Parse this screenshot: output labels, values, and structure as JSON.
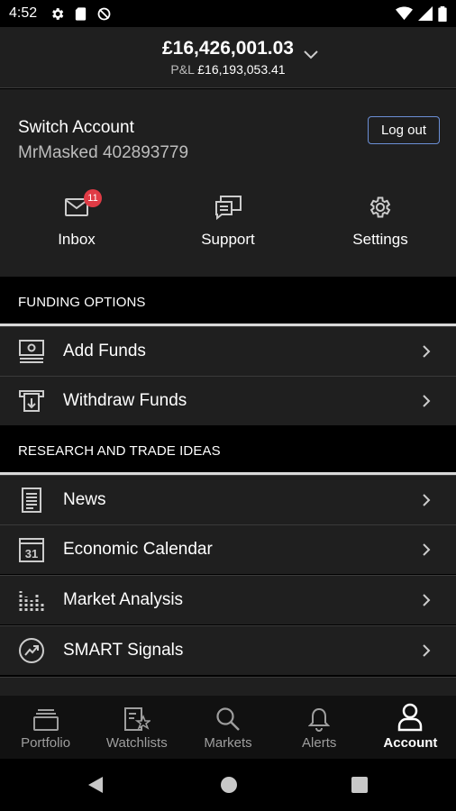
{
  "status_bar": {
    "time": "4:52",
    "left_icons": [
      "gear-icon",
      "sd-card-icon",
      "no-sync-icon"
    ],
    "right_icons": [
      "wifi-icon",
      "signal-icon",
      "battery-icon"
    ]
  },
  "header": {
    "balance": "£16,426,001.03",
    "pnl_label": "P&L",
    "pnl_value": "£16,193,053.41"
  },
  "account": {
    "switch_label": "Switch Account",
    "account_name": "MrMasked 402893779",
    "logout_label": "Log out"
  },
  "quick_actions": [
    {
      "label": "Inbox",
      "icon": "mail-icon",
      "badge": "11"
    },
    {
      "label": "Support",
      "icon": "chat-icon"
    },
    {
      "label": "Settings",
      "icon": "gear-icon"
    }
  ],
  "sections": {
    "funding": {
      "title": "FUNDING OPTIONS",
      "items": [
        {
          "label": "Add Funds",
          "icon": "add-funds-icon"
        },
        {
          "label": "Withdraw Funds",
          "icon": "withdraw-funds-icon"
        }
      ]
    },
    "research": {
      "title": "RESEARCH AND TRADE IDEAS",
      "items": [
        {
          "label": "News",
          "icon": "news-icon"
        },
        {
          "label": "Economic Calendar",
          "icon": "calendar-icon",
          "icon_text": "31"
        },
        {
          "label": "Market Analysis",
          "icon": "bar-chart-icon"
        },
        {
          "label": "SMART Signals",
          "icon": "trend-icon"
        }
      ]
    }
  },
  "tabs": [
    {
      "label": "Portfolio",
      "icon": "portfolio-icon",
      "active": false
    },
    {
      "label": "Watchlists",
      "icon": "watchlist-icon",
      "active": false
    },
    {
      "label": "Markets",
      "icon": "search-icon",
      "active": false
    },
    {
      "label": "Alerts",
      "icon": "bell-icon",
      "active": false
    },
    {
      "label": "Account",
      "icon": "person-icon",
      "active": true
    }
  ],
  "colors": {
    "background": "#1f1f1f",
    "section_bg": "#000000",
    "badge": "#e03b45",
    "logout_border": "#6b8fd6"
  }
}
